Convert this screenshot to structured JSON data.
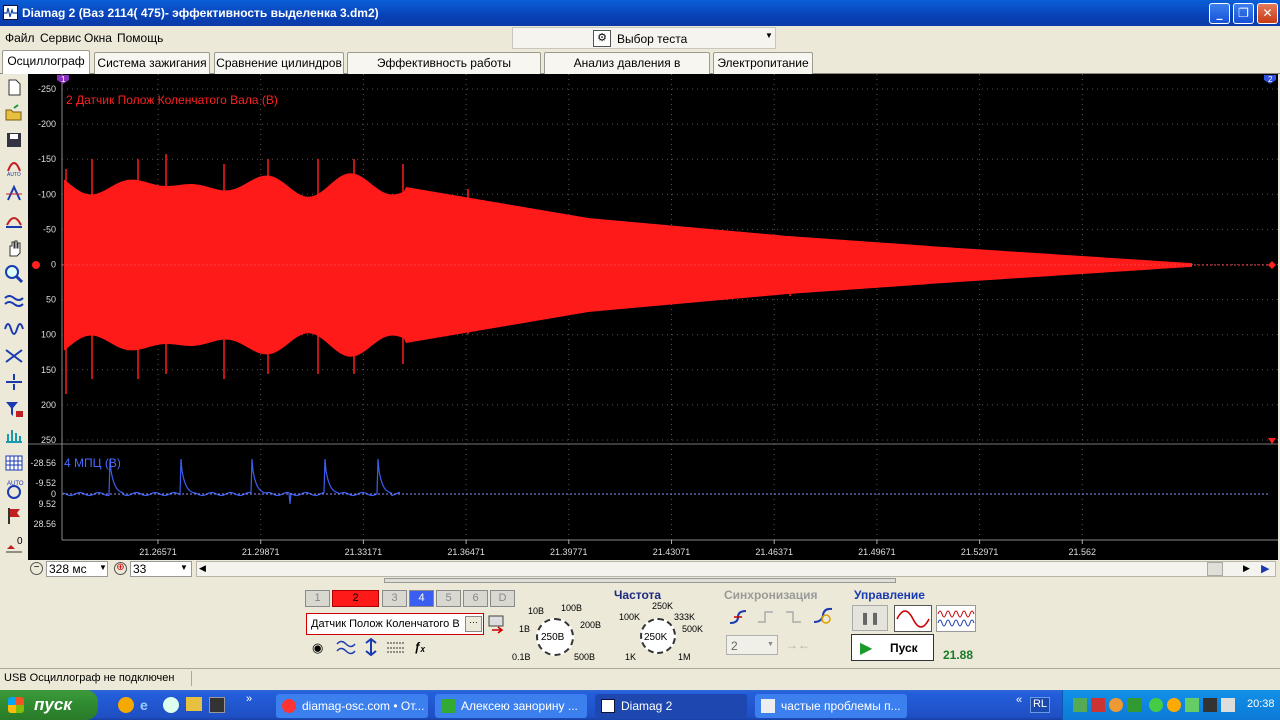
{
  "window": {
    "title": "Diamag 2 (Ваз 2114( 475)- эффективность выделенка 3.dm2)"
  },
  "menu": [
    "Файл",
    "Сервис",
    "Окна",
    "Помощь"
  ],
  "test_select": {
    "label": "Выбор теста"
  },
  "tabs": [
    "Осциллограф",
    "Система зажигания",
    "Сравнение цилиндров",
    "Эффективность работы цилиндров",
    "Анализ давления в цилиндре",
    "Электропитание"
  ],
  "scope": {
    "ch2_label": "2 Датчик Полож Коленчатого Вала (В)",
    "ch2_ticks": [
      "-250",
      "-200",
      "-150",
      "-100",
      "-50",
      "0",
      "50",
      "100",
      "150",
      "200",
      "250"
    ],
    "ch4_label": "4 МПЦ (В)",
    "ch4_ticks": [
      "-28.56",
      "-9.52",
      "0",
      "9.52",
      "28.56"
    ],
    "time_ticks": [
      "21.26571",
      "21.29871",
      "21.33171",
      "21.36471",
      "21.39771",
      "21.43071",
      "21.46371",
      "21.49671",
      "21.52971",
      "21.562"
    ],
    "marker_left": "1",
    "marker_right": "2",
    "zero_label": "0",
    "colors": {
      "ch2": "#ff1a1a",
      "ch4": "#3a5ff0",
      "background": "#000000",
      "grid": "#555555"
    }
  },
  "controls": {
    "timebase": "328 мс",
    "points": "33"
  },
  "channels": {
    "buttons": [
      "1",
      "2",
      "3",
      "4",
      "5",
      "6",
      "D"
    ],
    "sensor": "Датчик Полож Коленчатого В",
    "sensor_more": "···"
  },
  "range": {
    "ticks": [
      "10В",
      "100В",
      "1В",
      "200В",
      "0.1В",
      "500В"
    ],
    "value": "250В"
  },
  "frequency": {
    "title": "Частота",
    "ticks": [
      "250K",
      "100K",
      "333K",
      "500K",
      "1K",
      "1M"
    ],
    "value": "250K"
  },
  "sync": {
    "title": "Синхронизация",
    "channel": "2"
  },
  "control": {
    "title": "Управление",
    "start": "Пуск",
    "value": "21.88"
  },
  "status": {
    "text": "USB Осциллограф не подключен"
  },
  "taskbar": {
    "start": "пуск",
    "items": [
      "diamag-osc.com • От...",
      "Алексею занорину ...",
      "Diamag 2",
      "частые проблемы п..."
    ],
    "lang": "RL",
    "clock": "20:38"
  }
}
